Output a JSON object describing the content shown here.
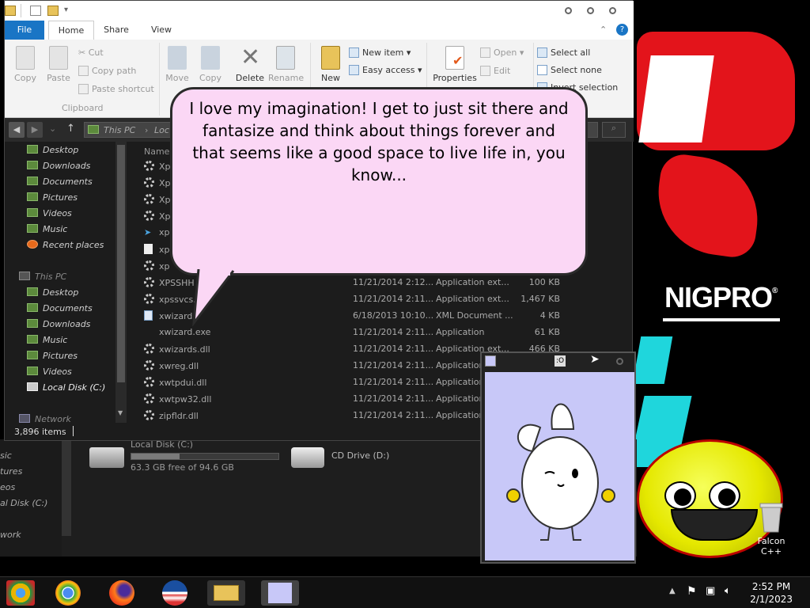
{
  "wallpaper": {
    "brand": "NIGPRO",
    "brand_mark": "®",
    "desktop_icon_label": "Falcon C++"
  },
  "explorer": {
    "tabs": [
      "File",
      "Home",
      "Share",
      "View"
    ],
    "ribbon": {
      "clipboard": {
        "copy": "Copy",
        "paste": "Paste",
        "cut": "Cut",
        "copy_path": "Copy path",
        "paste_shortcut": "Paste shortcut",
        "group": "Clipboard"
      },
      "organize": {
        "move_to": "Move",
        "copy_to": "Copy",
        "delete": "Delete",
        "rename": "Rename"
      },
      "new": {
        "new_folder": "New",
        "new_item": "New item",
        "easy_access": "Easy access"
      },
      "open": {
        "properties": "Properties",
        "open": "Open",
        "edit": "Edit"
      },
      "select": {
        "select_all": "Select all",
        "select_none": "Select none",
        "invert": "Invert selection"
      }
    },
    "address": {
      "crumb1": "This PC",
      "crumb2": "Loc"
    },
    "nav": {
      "quick": [
        "Desktop",
        "Downloads",
        "Documents",
        "Pictures",
        "Videos",
        "Music",
        "Recent places"
      ],
      "this_pc": "This PC",
      "pc_items": [
        "Desktop",
        "Documents",
        "Downloads",
        "Music",
        "Pictures",
        "Videos",
        "Local Disk (C:)"
      ],
      "network": "Network"
    },
    "list_header": "Name",
    "rows": [
      {
        "name": "XPSSHH",
        "date": "11/21/2014 2:12...",
        "type": "Application ext...",
        "size": "100 KB"
      },
      {
        "name": "xpssvcs.",
        "date": "11/21/2014 2:11...",
        "type": "Application ext...",
        "size": "1,467 KB"
      },
      {
        "name": "xwizard",
        "date": "6/18/2013 10:10...",
        "type": "XML Document ...",
        "size": "4 KB"
      },
      {
        "name": "xwizard.exe",
        "date": "11/21/2014 2:11...",
        "type": "Application",
        "size": "61 KB"
      },
      {
        "name": "xwizards.dll",
        "date": "11/21/2014 2:11...",
        "type": "Application ext...",
        "size": "466 KB"
      },
      {
        "name": "xwreg.dll",
        "date": "11/21/2014 2:11...",
        "type": "Application",
        "size": ""
      },
      {
        "name": "xwtpdui.dll",
        "date": "11/21/2014 2:11...",
        "type": "Application",
        "size": ""
      },
      {
        "name": "xwtpw32.dll",
        "date": "11/21/2014 2:11...",
        "type": "Application",
        "size": ""
      },
      {
        "name": "zipfldr.dll",
        "date": "11/21/2014 2:11...",
        "type": "Application",
        "size": ""
      }
    ],
    "partial_rows": [
      "Xp",
      "Xp",
      "Xp",
      "Xp",
      "xp",
      "xp",
      "xp"
    ],
    "status": "3,896 items"
  },
  "background_window": {
    "drive1": "Local Disk (C:)",
    "drive1_free": "63.3 GB free of 94.6 GB",
    "drive1_used_fraction": 0.33,
    "drive2": "CD Drive (D:)",
    "nav_partial": [
      "sic",
      "tures",
      "eos",
      "al Disk (C:)",
      "work"
    ]
  },
  "speech_bubble": {
    "text": "I love my imagination! I get to just sit there and fantasize and think about things forever and that seems like a good space to live life in, you know..."
  },
  "bunny_window": {
    "title_mark": ":O"
  },
  "taskbar": {
    "time": "2:52 PM",
    "date": "2/1/2023",
    "apps": [
      "chrome-canary-icon",
      "chrome-icon",
      "firefox-icon",
      "obama-logo-icon",
      "file-explorer-icon",
      "bunny-app-icon"
    ]
  }
}
